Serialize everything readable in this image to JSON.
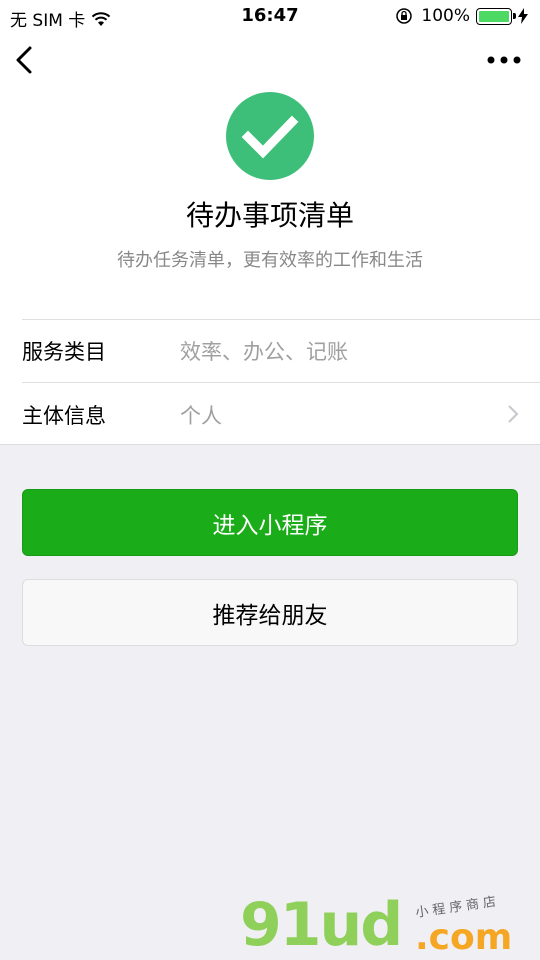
{
  "status_bar": {
    "carrier": "无 SIM 卡",
    "time": "16:47",
    "battery": "100%"
  },
  "nav": {
    "back_icon": "chevron-left-icon",
    "more_icon": "ellipsis-icon"
  },
  "app": {
    "icon": "check-circle-icon",
    "icon_color": "#3dbf7a",
    "name": "待办事项清单",
    "description": "待办任务清单，更有效率的工作和生活"
  },
  "info": {
    "category_label": "服务类目",
    "category_value": "效率、办公、记账",
    "subject_label": "主体信息",
    "subject_value": "个人"
  },
  "actions": {
    "enter_label": "进入小程序",
    "enter_color": "#1aad19",
    "share_label": "推荐给朋友"
  },
  "watermark": {
    "brand": "91ud",
    "suffix": ".com",
    "tagline": "小程序商店"
  }
}
